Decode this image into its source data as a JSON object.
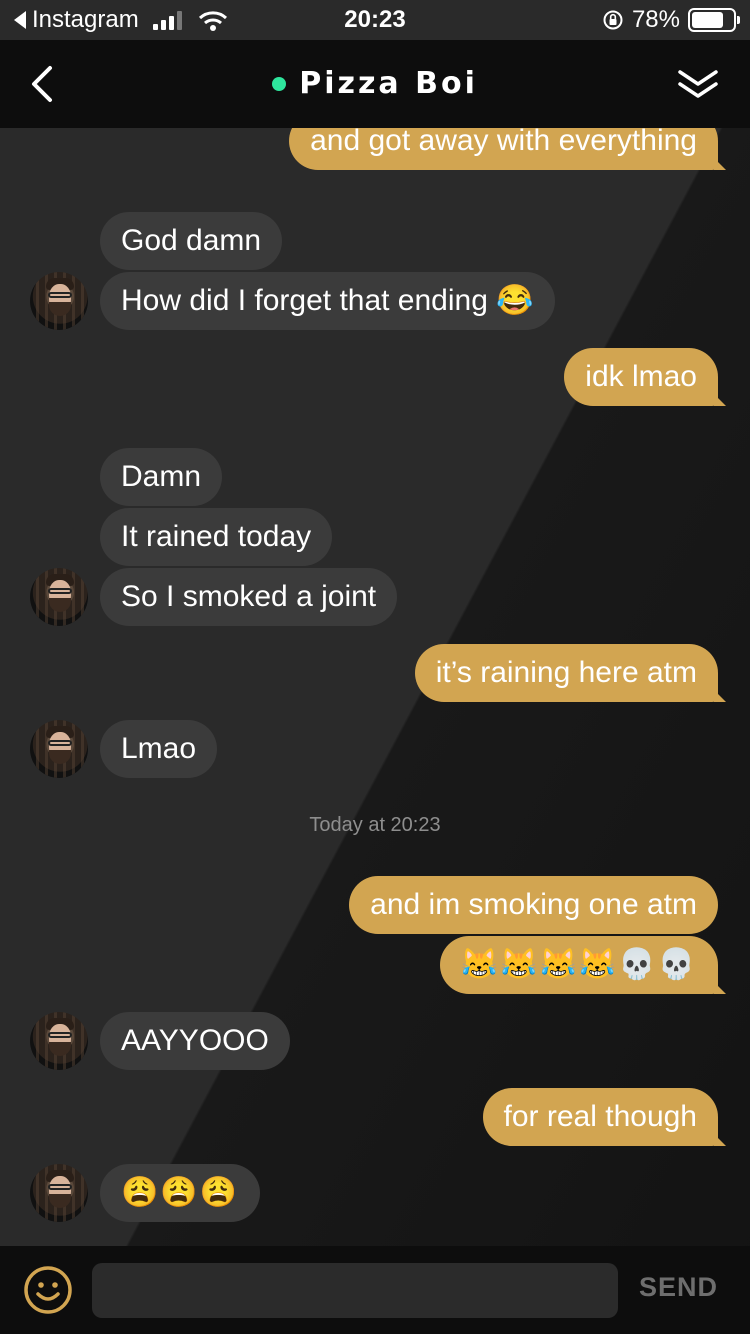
{
  "status_bar": {
    "back_app": "Instagram",
    "time": "20:23",
    "battery": "78%",
    "battery_level": 0.78
  },
  "header": {
    "title": "Pizza Boi",
    "online_color": "#2ee59d"
  },
  "messages": [
    {
      "side": "out",
      "text": "and got away with everything"
    },
    {
      "side": "in",
      "text": "God damn"
    },
    {
      "side": "in",
      "text": "How did I forget that ending 😂"
    },
    {
      "side": "out",
      "text": "idk lmao"
    },
    {
      "side": "in",
      "text": "Damn"
    },
    {
      "side": "in",
      "text": "It rained today"
    },
    {
      "side": "in",
      "text": "So I smoked a joint"
    },
    {
      "side": "out",
      "text": "it’s raining here atm"
    },
    {
      "side": "in",
      "text": "Lmao"
    },
    {
      "side": "out",
      "text": "and im smoking one atm"
    },
    {
      "side": "out",
      "text": "😹😹😹😹💀💀"
    },
    {
      "side": "in",
      "text": "AAYYOOO"
    },
    {
      "side": "out",
      "text": "for real though"
    },
    {
      "side": "in",
      "text": "😩😩😩"
    }
  ],
  "timestamp": "Today at 20:23",
  "composer": {
    "send_label": "SEND",
    "placeholder": ""
  },
  "colors": {
    "outgoing_bubble": "#d2a551",
    "incoming_bubble": "#3b3b3b",
    "bar_background": "#0d0d0d"
  }
}
